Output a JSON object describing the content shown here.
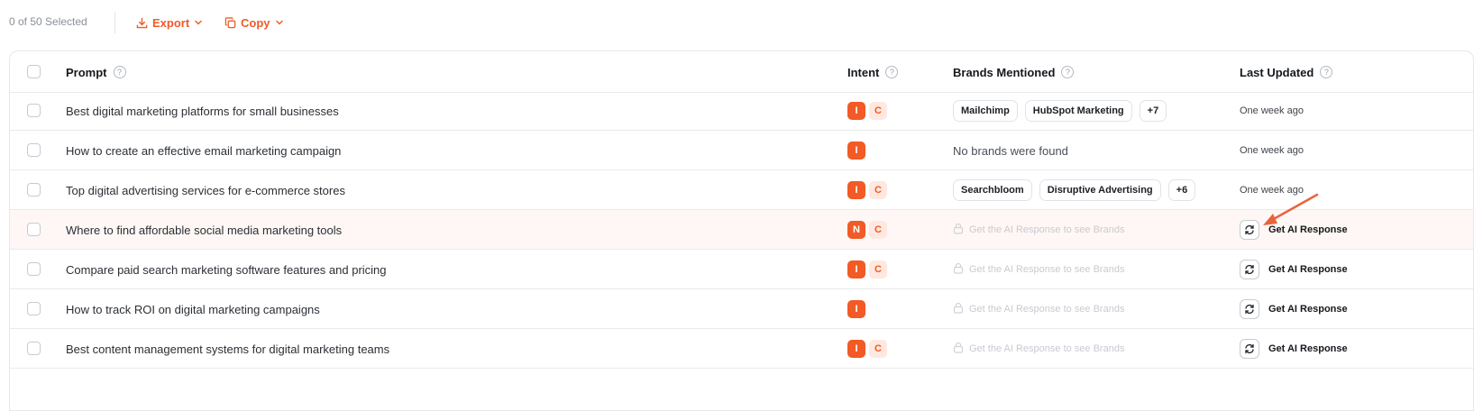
{
  "toolbar": {
    "selection_count": "0 of 50 Selected",
    "export_label": "Export",
    "copy_label": "Copy"
  },
  "table": {
    "headers": {
      "prompt": "Prompt",
      "intent": "Intent",
      "brands": "Brands Mentioned",
      "last_updated": "Last Updated"
    },
    "help_glyph": "?",
    "rows": [
      {
        "prompt": "Best digital marketing platforms for small businesses",
        "intents": [
          "I",
          "C"
        ],
        "brands": [
          "Mailchimp",
          "HubSpot Marketing",
          "+7"
        ],
        "last_updated": "One week ago"
      },
      {
        "prompt": "How to create an effective email marketing campaign",
        "intents": [
          "I"
        ],
        "no_brands": "No brands were found",
        "last_updated": "One week ago"
      },
      {
        "prompt": "Top digital advertising services for e-commerce stores",
        "intents": [
          "I",
          "C"
        ],
        "brands": [
          "Searchbloom",
          "Disruptive Advertising",
          "+6"
        ],
        "last_updated": "One week ago"
      },
      {
        "prompt": "Where to find affordable social media marketing tools",
        "intents": [
          "N",
          "C"
        ],
        "locked_text": "Get the AI Response to see Brands",
        "action": "Get AI Response",
        "highlighted": true
      },
      {
        "prompt": "Compare paid search marketing software features and pricing",
        "intents": [
          "I",
          "C"
        ],
        "locked_text": "Get the AI Response to see Brands",
        "action": "Get AI Response"
      },
      {
        "prompt": "How to track ROI on digital marketing campaigns",
        "intents": [
          "I"
        ],
        "locked_text": "Get the AI Response to see Brands",
        "action": "Get AI Response"
      },
      {
        "prompt": "Best content management systems for digital marketing teams",
        "intents": [
          "I",
          "C"
        ],
        "locked_text": "Get the AI Response to see Brands",
        "action": "Get AI Response"
      }
    ]
  },
  "colors": {
    "accent": "#f25a26",
    "accent_soft": "#ffe8df",
    "highlight_row": "#fff7f5",
    "annotation_arrow": "#e8643c"
  },
  "icons": {
    "export": "download-icon",
    "copy": "copy-icon",
    "dropdown": "chevron-down-icon",
    "help": "help-circle-icon",
    "lock": "lock-icon",
    "refresh": "refresh-icon",
    "annotation": "arrow-annotation"
  }
}
